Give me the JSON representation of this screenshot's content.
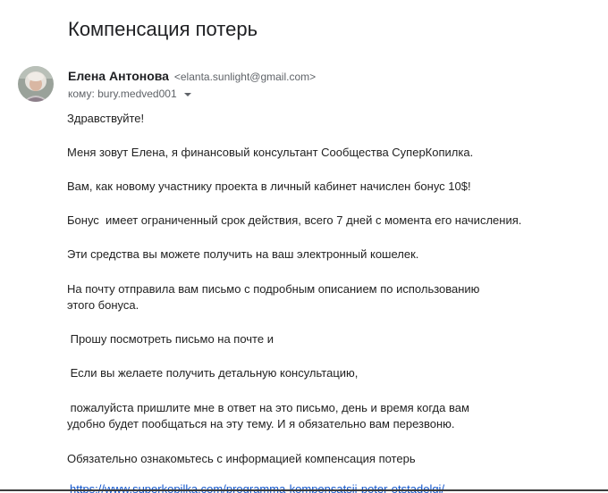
{
  "email": {
    "subject": "Компенсация потерь",
    "sender": {
      "name": "Елена Антонова",
      "email": "<elanta.sunlight@gmail.com>",
      "avatar_icon": "avatar-photo"
    },
    "recipient": {
      "label": "кому: bury.medved001",
      "dropdown_icon": "caret-down-icon"
    },
    "body": {
      "greeting": "Здравствуйте!",
      "p1": "Меня зовут Елена, я финансовый консультант Сообщества СуперКопилка.",
      "p2": "Вам, как новому участнику проекта в личный кабинет начислен бонус 10$!",
      "p3": "Бонус  имеет ограниченный срок действия, всего 7 дней с момента его начисления.",
      "p4": "Эти средства вы можете получить на ваш электронный кошелек.",
      "p5_line1": "На почту отправила вам письмо с подробным описанием по использованию",
      "p5_line2": "этого бонуса.",
      "p6": " Прошу посмотреть письмо на почте и",
      "p7": " Если вы желаете получить детальную консультацию,",
      "p8_line1": " пожалуйста пришлите мне в ответ на это письмо, день и время когда вам",
      "p8_line2": "удобно будет пообщаться на эту тему. И я обязательно вам перезвоню.",
      "p9": "Обязательно ознакомьтесь с информацией компенсация потерь",
      "link": "https://www.superkopilka.com/programma-kompensatsii-poter-otstadelgi/"
    }
  },
  "colors": {
    "link": "#1155cc",
    "text": "#222222",
    "muted": "#5f6368"
  }
}
